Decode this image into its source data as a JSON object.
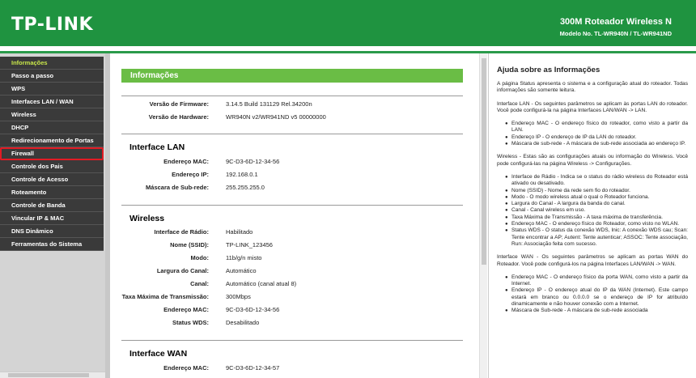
{
  "header": {
    "logo": "TP-LINK",
    "product": "300M Roteador Wireless N",
    "model": "Modelo No. TL-WR940N / TL-WR941ND"
  },
  "sidebar": {
    "items": [
      {
        "label": "Informações"
      },
      {
        "label": "Passo a passo"
      },
      {
        "label": "WPS"
      },
      {
        "label": "Interfaces LAN / WAN"
      },
      {
        "label": "Wireless"
      },
      {
        "label": "DHCP"
      },
      {
        "label": "Redirecionamento de Portas"
      },
      {
        "label": "Firewall"
      },
      {
        "label": "Controle dos Pais"
      },
      {
        "label": "Controle de Acesso"
      },
      {
        "label": "Roteamento"
      },
      {
        "label": "Controle de Banda"
      },
      {
        "label": "Vincular IP & MAC"
      },
      {
        "label": "DNS Dinâmico"
      },
      {
        "label": "Ferramentas do Sistema"
      }
    ]
  },
  "main": {
    "title": "Informações",
    "firmware_label": "Versão de Firmware:",
    "firmware_value": "3.14.5 Build 131129 Rel.34200n",
    "hardware_label": "Versão de Hardware:",
    "hardware_value": "WR940N v2/WR941ND v5 00000000",
    "lan": {
      "title": "Interface LAN",
      "mac_label": "Endereço MAC:",
      "mac_value": "9C-D3-6D-12-34-56",
      "ip_label": "Endereço IP:",
      "ip_value": "192.168.0.1",
      "mask_label": "Máscara de Sub-rede:",
      "mask_value": "255.255.255.0"
    },
    "wireless": {
      "title": "Wireless",
      "radio_label": "Interface de Rádio:",
      "radio_value": "Habilitado",
      "ssid_label": "Nome (SSID):",
      "ssid_value": "TP-LINK_123456",
      "mode_label": "Modo:",
      "mode_value": "11b/g/n misto",
      "width_label": "Largura do Canal:",
      "width_value": "Automático",
      "channel_label": "Canal:",
      "channel_value": "Automático (canal atual 8)",
      "rate_label": "Taxa Máxima de Transmissão:",
      "rate_value": "300Mbps",
      "mac_label": "Endereço MAC:",
      "mac_value": "9C-D3-6D-12-34-56",
      "wds_label": "Status WDS:",
      "wds_value": "Desabilitado"
    },
    "wan": {
      "title": "Interface WAN",
      "mac_label": "Endereço MAC:",
      "mac_value": "9C-D3-6D-12-34-57"
    }
  },
  "help": {
    "title": "Ajuda sobre as Informações",
    "intro": "A página Status apresenta o sistema e a configuração atual do roteador. Todas informações são somente leitura.",
    "lan_intro": "Interface LAN - Os seguintes parâmetros se aplicam às portas LAN do roteador. Você pode configurá-la na página Interfaces LAN/WAN -> LAN.",
    "lan_items": [
      "Endereço MAC - O endereço físico do roteador, como visto a partir da LAN.",
      "Endereço IP - O endereço de IP da LAN do roteador.",
      "Máscara de sub-rede - A máscara de sub-rede associada ao endereço IP."
    ],
    "wireless_intro": "Wireless - Estas são as configurações atuais ou informação do Wireless. Você pode configurá-las na página Wireless -> Configurações.",
    "wireless_items": [
      "Interface de Rádio - Indica se o status do rádio wireless do Roteador está ativado ou desativado.",
      "Nome (SSID) - Nome da rede sem fio do roteador.",
      "Modo - O modo wireless atual o qual o Roteador funciona.",
      "Largura do Canal - A largura da banda do canal.",
      "Canal - Canal wireless em uso.",
      "Taxa Máxima de Transmissão - A taxa máxima de transferência.",
      "Endereço MAC - O endereço físico do Roteador, como visto no WLAN.",
      "Status WDS - O status da conexão WDS, Inic: A conexão WDS cau; Scan: Tente encontrar a AP; Autent: Tente autenticar; ASSOC: Tente associação, Run: Associação feita com sucesso."
    ],
    "wan_intro": "Interface WAN - Os seguintes parâmetros se aplicam as portas WAN do Roteador. Você pode configurá-los na página Interfaces LAN/WAN -> WAN.",
    "wan_items": [
      "Endereço MAC - O endereço físico da porta WAN, como visto a partir da Internet.",
      "Endereço IP - O endereço atual do IP da WAN (Internet). Este campo estará em branco ou 0.0.0.0 se o endereço de IP for atribuído dinamicamente e não houver conexão com a Internet.",
      "Máscara de Sub-rede - A máscara de sub-rede associada"
    ]
  }
}
